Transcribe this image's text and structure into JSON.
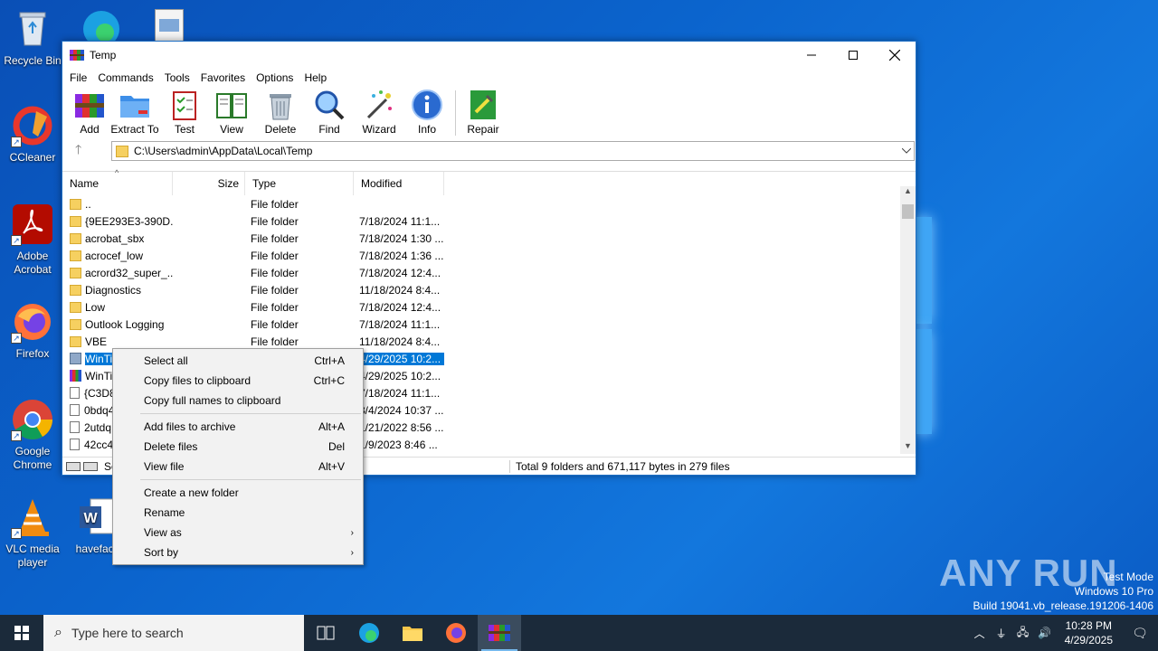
{
  "desktop": {
    "icons": [
      {
        "label": "Recycle Bin"
      },
      {
        "label": "CCleaner"
      },
      {
        "label": "Adobe Acrobat"
      },
      {
        "label": "Firefox"
      },
      {
        "label": "Google Chrome"
      },
      {
        "label": "VLC media player"
      },
      {
        "label": "havefacu"
      }
    ],
    "watermark": "ANY RUN",
    "test_mode": {
      "line1": "Test Mode",
      "line2": "Windows 10 Pro",
      "line3": "Build 19041.vb_release.191206-1406"
    }
  },
  "window": {
    "title": "Temp",
    "menu": [
      "File",
      "Commands",
      "Tools",
      "Favorites",
      "Options",
      "Help"
    ],
    "toolbar": [
      "Add",
      "Extract To",
      "Test",
      "View",
      "Delete",
      "Find",
      "Wizard",
      "Info",
      "Repair"
    ],
    "address": "C:\\Users\\admin\\AppData\\Local\\Temp",
    "columns": {
      "name": "Name",
      "size": "Size",
      "type": "Type",
      "modified": "Modified"
    },
    "rows": [
      {
        "name": "..",
        "size": "",
        "type": "File folder",
        "modified": "",
        "icon": "folder"
      },
      {
        "name": "{9EE293E3-390D...",
        "size": "",
        "type": "File folder",
        "modified": "7/18/2024 11:1...",
        "icon": "folder"
      },
      {
        "name": "acrobat_sbx",
        "size": "",
        "type": "File folder",
        "modified": "7/18/2024 1:30 ...",
        "icon": "folder"
      },
      {
        "name": "acrocef_low",
        "size": "",
        "type": "File folder",
        "modified": "7/18/2024 1:36 ...",
        "icon": "folder"
      },
      {
        "name": "acrord32_super_...",
        "size": "",
        "type": "File folder",
        "modified": "7/18/2024 12:4...",
        "icon": "folder"
      },
      {
        "name": "Diagnostics",
        "size": "",
        "type": "File folder",
        "modified": "11/18/2024 8:4...",
        "icon": "folder"
      },
      {
        "name": "Low",
        "size": "",
        "type": "File folder",
        "modified": "7/18/2024 12:4...",
        "icon": "folder"
      },
      {
        "name": "Outlook Logging",
        "size": "",
        "type": "File folder",
        "modified": "7/18/2024 11:1...",
        "icon": "folder"
      },
      {
        "name": "VBE",
        "size": "",
        "type": "File folder",
        "modified": "11/18/2024 8:4...",
        "icon": "folder"
      },
      {
        "name": "WinTi",
        "size": "",
        "type": "",
        "modified": "4/29/2025 10:2...",
        "icon": "selected"
      },
      {
        "name": "WinTi",
        "size": "",
        "type": "",
        "modified": "4/29/2025 10:2...",
        "icon": "rar"
      },
      {
        "name": "{C3D8",
        "size": "",
        "type": "",
        "modified": "7/18/2024 11:1...",
        "icon": "file"
      },
      {
        "name": "0bdq4",
        "size": "",
        "type": "",
        "modified": "3/4/2024 10:37 ...",
        "icon": "file"
      },
      {
        "name": "2utdq",
        "size": "",
        "type": "",
        "modified": "1/21/2022 8:56 ...",
        "icon": "file"
      },
      {
        "name": "42cc4",
        "size": "",
        "type": "",
        "modified": "1/9/2023 8:46 ...",
        "icon": "file"
      }
    ],
    "status_left": "Se",
    "status_right": "Total 9 folders and 671,117 bytes in 279 files"
  },
  "context_menu": {
    "groups": [
      [
        {
          "label": "Select all",
          "key": "Ctrl+A"
        },
        {
          "label": "Copy files to clipboard",
          "key": "Ctrl+C"
        },
        {
          "label": "Copy full names to clipboard",
          "key": ""
        }
      ],
      [
        {
          "label": "Add files to archive",
          "key": "Alt+A"
        },
        {
          "label": "Delete files",
          "key": "Del"
        },
        {
          "label": "View file",
          "key": "Alt+V"
        }
      ],
      [
        {
          "label": "Create a new folder",
          "key": ""
        },
        {
          "label": "Rename",
          "key": ""
        },
        {
          "label": "View as",
          "key": "",
          "submenu": true
        },
        {
          "label": "Sort by",
          "key": "",
          "submenu": true
        }
      ]
    ]
  },
  "taskbar": {
    "search_placeholder": "Type here to search",
    "time": "10:28 PM",
    "date": "4/29/2025"
  }
}
